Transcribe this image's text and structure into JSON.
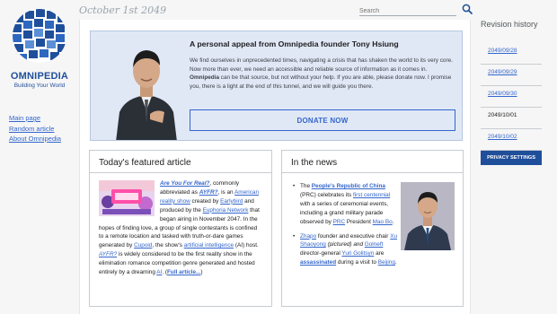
{
  "site": {
    "name": "OMNIPEDIA",
    "tagline": "Building Your World"
  },
  "header": {
    "date": "October 1st 2049",
    "search_placeholder": "Search"
  },
  "left_nav": [
    {
      "label": "Main page"
    },
    {
      "label": "Random article"
    },
    {
      "label": "About Omnipedia"
    }
  ],
  "appeal": {
    "title": "A personal appeal from Omnipedia founder Tony Hsiung",
    "text_before": "We find ourselves in unprecedented times, navigating a crisis that has shaken the world to its very core. Now more than ever, we need an accessible and reliable source of information as it comes in. ",
    "brand_bold": "Omnipedia",
    "text_after": " can be that source, but not without your help. If you are able, please donate now. I promise you, there is a light at the end of this tunnel, and we will guide you there.",
    "donate_label": "DONATE NOW"
  },
  "featured": {
    "heading": "Today's featured article",
    "title": "Are You For Real?",
    "t1": ", commonly abbreviated as ",
    "abbr": "AYFR?",
    "t2": ", is an ",
    "link1": "American reality show",
    "t3": " created by ",
    "link2": "Earlybird",
    "t4": " and produced by the ",
    "link3": "Euphoria Network",
    "t5": " that began airing in November 2047. In the hopes of finding love, a group of single contestants is confined to a remote location and tasked with truth-or-dare games generated by ",
    "link4": "Cupoid",
    "t6": ", the show's ",
    "link5": "artificial intelligence",
    "t7": " (AI) host. ",
    "abbr2": "AYFR?",
    "t8": " is widely considered to be the first reality show in the elimination romance competition genre generated and hosted entirely by a dreaming ",
    "link6": "AI",
    "t9": ". (",
    "more": "Full article...",
    "t10": ")"
  },
  "news": {
    "heading": "In the news",
    "item1": {
      "t1": "The ",
      "link1": "People's Republic of China",
      "t2": " (PRC) celebrates its ",
      "link2": "first centennial",
      "t3": " with a series of ceremonial events, including a grand military parade observed by ",
      "link3": "PRC",
      "t4": " President ",
      "link4": "Mao Bo",
      "t5": "."
    },
    "item2": {
      "link1": "Zhapo",
      "t1": " founder and executive chair ",
      "link2": "Xu Shaoyong",
      "t2": " (pictured) and ",
      "link3": "Golneft",
      "t3": " director-general ",
      "link4": "Yuri Golitsyn",
      "t4": " are ",
      "link5": "assassinated",
      "t5": " during a visit to ",
      "link6": "Beijing",
      "t6": "."
    }
  },
  "revision": {
    "title": "Revision history",
    "items": [
      {
        "date": "2049/09/28"
      },
      {
        "date": "2049/09/29"
      },
      {
        "date": "2049/09/30"
      },
      {
        "date": "2049/10/01"
      },
      {
        "date": "2049/10/02"
      }
    ],
    "privacy_label": "PRIVACY SETTINGS"
  },
  "colors": {
    "brand": "#1f4f9a",
    "link": "#3366cc",
    "appeal_bg": "#e0e8f6"
  }
}
